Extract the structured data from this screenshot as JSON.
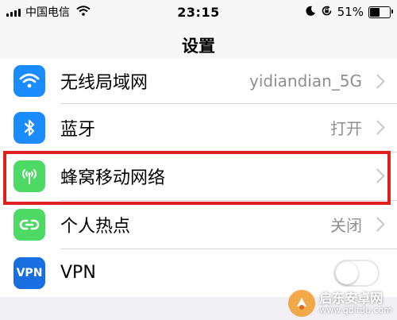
{
  "status_bar": {
    "carrier": "中国电信",
    "time": "23:15",
    "battery": "51%",
    "battery_level": 0.51
  },
  "nav": {
    "title": "设置"
  },
  "rows": [
    {
      "label": "无线局域网",
      "value": "yidiandian_5G",
      "icon": "wifi-icon",
      "icon_bg": "#1a8cff"
    },
    {
      "label": "蓝牙",
      "value": "打开",
      "icon": "bluetooth-icon",
      "icon_bg": "#1a8cff"
    },
    {
      "label": "蜂窝移动网络",
      "value": "",
      "icon": "cellular-antenna-icon",
      "icon_bg": "#4cd964"
    },
    {
      "label": "个人热点",
      "value": "关闭",
      "icon": "hotspot-icon",
      "icon_bg": "#4cd964"
    },
    {
      "label": "VPN",
      "icon_text": "VPN",
      "icon": "vpn-icon",
      "icon_bg": "#1a6fe0",
      "toggle": false
    }
  ],
  "highlight_color": "#e02020",
  "watermark": {
    "name": "启东安卓网",
    "url": "www.qdltdu.com"
  }
}
